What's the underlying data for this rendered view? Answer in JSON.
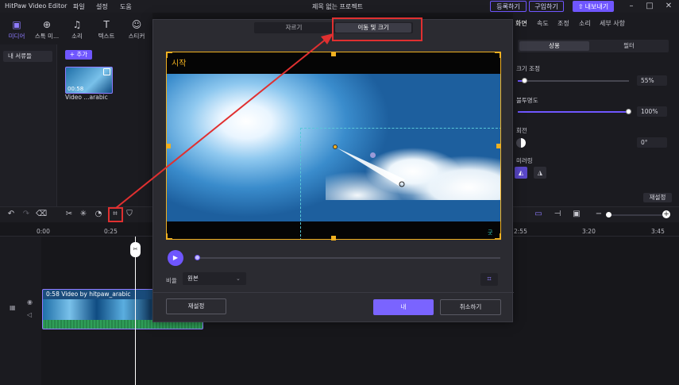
{
  "app": {
    "name": "HitPaw Video Editor",
    "project_title": "제목 없는 프로젝트"
  },
  "menu": {
    "items": [
      "파일",
      "설정",
      "도움"
    ]
  },
  "titlebar": {
    "register": "등록하기",
    "buy": "구입하기",
    "export": "내보내기"
  },
  "left_panel": {
    "tabs": [
      {
        "label": "미디어",
        "icon": "media-icon"
      },
      {
        "label": "스톡 미...",
        "icon": "globe-icon"
      },
      {
        "label": "소리",
        "icon": "music-icon"
      },
      {
        "label": "텍스트",
        "icon": "text-icon"
      },
      {
        "label": "스티커",
        "icon": "smiley-icon"
      }
    ],
    "folder": "내 서류들",
    "add_button": "+ 추가",
    "thumb": {
      "duration": "00:58",
      "name": "Video ...arabic"
    }
  },
  "right_panel": {
    "tabs": [
      "화면",
      "속도",
      "조정",
      "소리",
      "세부 사항"
    ],
    "segment": [
      "상용",
      "필터"
    ],
    "scale_label": "크기 조정",
    "scale_value": "55%",
    "scale_level": 0.55,
    "opacity_label": "불투명도",
    "opacity_value": "100%",
    "opacity_level": 1.0,
    "rotate_label": "회전",
    "rotate_value": "0°",
    "mirror_label": "미러링",
    "reset": "재설정"
  },
  "timeline": {
    "ticks": [
      "0:00",
      "0:25",
      "2:55",
      "3:20",
      "3:45"
    ],
    "clip_label": "0:58   Video by hitpaw_arabic"
  },
  "modal": {
    "tabs": {
      "crop": "자르기",
      "move": "이동 및 크기"
    },
    "start_label": "시작",
    "watermark": "굿",
    "ratio_label": "비율",
    "ratio_value": "원본",
    "reset": "재설정",
    "ok": "내",
    "cancel": "취소하기"
  },
  "colors": {
    "accent": "#6f56ff",
    "crop_frame": "#f0b020",
    "annotation": "#e03030",
    "selection": "#58c8d8"
  }
}
